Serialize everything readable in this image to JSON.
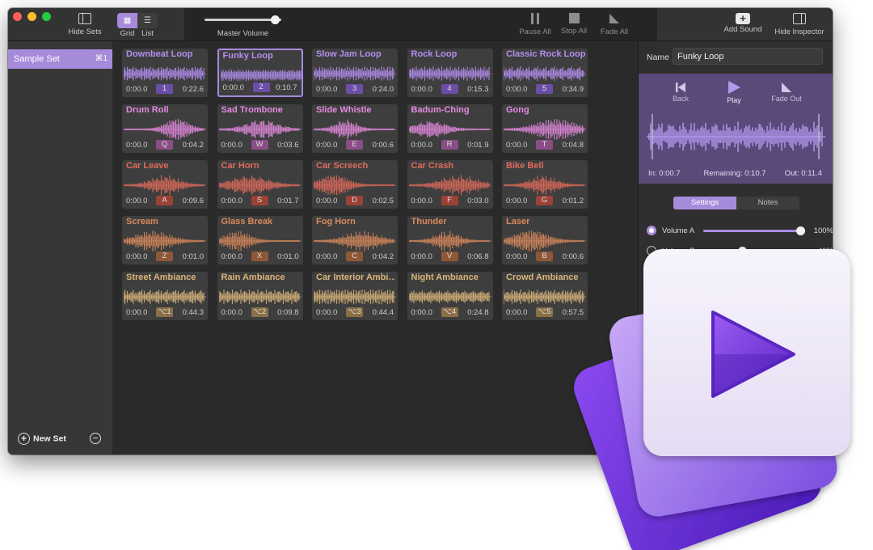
{
  "toolbar": {
    "hide_sets": "Hide Sets",
    "grid": "Grid",
    "list": "List",
    "master_volume": "Master Volume",
    "master_volume_level": 0.92,
    "pause_all": "Pause All",
    "stop_all": "Stop All",
    "fade_all": "Fade All",
    "add_sound": "Add Sound",
    "hide_inspector": "Hide Inspector"
  },
  "sidebar": {
    "sets": [
      {
        "name": "Sample Set",
        "shortcut": "⌘1",
        "selected": true
      }
    ],
    "new_set": "New Set"
  },
  "colors": {
    "purple": "#b48ef0",
    "pink": "#e58be0",
    "red": "#e06b5c",
    "orange": "#d98a5c",
    "yellow": "#d9b57a"
  },
  "sounds": [
    {
      "name": "Downbeat Loop",
      "start": "0:00.0",
      "key": "1",
      "end": "0:22.6",
      "color": "purple"
    },
    {
      "name": "Funky Loop",
      "start": "0:00.0",
      "key": "2",
      "end": "0:10.7",
      "color": "purple",
      "selected": true
    },
    {
      "name": "Slow Jam Loop",
      "start": "0:00.0",
      "key": "3",
      "end": "0:24.0",
      "color": "purple"
    },
    {
      "name": "Rock Loop",
      "start": "0:00.0",
      "key": "4",
      "end": "0:15.3",
      "color": "purple"
    },
    {
      "name": "Classic Rock Loop",
      "start": "0:00.0",
      "key": "5",
      "end": "0:34.9",
      "color": "purple"
    },
    {
      "name": "Drum Roll",
      "start": "0:00.0",
      "key": "Q",
      "end": "0:04.2",
      "color": "pink"
    },
    {
      "name": "Sad Trombone",
      "start": "0:00.0",
      "key": "W",
      "end": "0:03.6",
      "color": "pink"
    },
    {
      "name": "Slide Whistle",
      "start": "0:00.0",
      "key": "E",
      "end": "0:00.6",
      "color": "pink"
    },
    {
      "name": "Badum-Ching",
      "start": "0:00.0",
      "key": "R",
      "end": "0:01.9",
      "color": "pink"
    },
    {
      "name": "Gong",
      "start": "0:00.0",
      "key": "T",
      "end": "0:04.8",
      "color": "pink"
    },
    {
      "name": "Car Leave",
      "start": "0:00.0",
      "key": "A",
      "end": "0:09.6",
      "color": "red"
    },
    {
      "name": "Car Horn",
      "start": "0:00.0",
      "key": "S",
      "end": "0:01.7",
      "color": "red"
    },
    {
      "name": "Car Screech",
      "start": "0:00.0",
      "key": "D",
      "end": "0:02.5",
      "color": "red"
    },
    {
      "name": "Car Crash",
      "start": "0:00.0",
      "key": "F",
      "end": "0:03.0",
      "color": "red"
    },
    {
      "name": "Bike Bell",
      "start": "0:00.0",
      "key": "G",
      "end": "0:01.2",
      "color": "red"
    },
    {
      "name": "Scream",
      "start": "0:00.0",
      "key": "Z",
      "end": "0:01.0",
      "color": "orange"
    },
    {
      "name": "Glass Break",
      "start": "0:00.0",
      "key": "X",
      "end": "0:01.0",
      "color": "orange"
    },
    {
      "name": "Fog Horn",
      "start": "0:00.0",
      "key": "C",
      "end": "0:04.2",
      "color": "orange"
    },
    {
      "name": "Thunder",
      "start": "0:00.0",
      "key": "V",
      "end": "0:06.8",
      "color": "orange"
    },
    {
      "name": "Laser",
      "start": "0:00.0",
      "key": "B",
      "end": "0:00.6",
      "color": "orange"
    },
    {
      "name": "Street Ambiance",
      "start": "0:00.0",
      "key": "⌥1",
      "end": "0:44.3",
      "color": "yellow"
    },
    {
      "name": "Rain Ambiance",
      "start": "0:00.0",
      "key": "⌥2",
      "end": "0:09.8",
      "color": "yellow"
    },
    {
      "name": "Car Interior Ambi…",
      "start": "0:00.0",
      "key": "⌥3",
      "end": "0:44.4",
      "color": "yellow"
    },
    {
      "name": "Night Ambiance",
      "start": "0:00.0",
      "key": "⌥4",
      "end": "0:24.8",
      "color": "yellow"
    },
    {
      "name": "Crowd Ambiance",
      "start": "0:00.0",
      "key": "⌥5",
      "end": "0:57.5",
      "color": "yellow"
    }
  ],
  "inspector": {
    "name_label": "Name",
    "name_value": "Funky Loop",
    "back": "Back",
    "play": "Play",
    "fade_out": "Fade Out",
    "in": "In: 0:00.7",
    "remaining": "Remaining: 0:10.7",
    "out": "Out: 0:11.4",
    "tabs": {
      "settings": "Settings",
      "notes": "Notes",
      "active": "settings"
    },
    "volume_a": {
      "label": "Volume A",
      "pct": "100%",
      "level": 1.0,
      "selected": true
    },
    "volume_b": {
      "label": "Volume B",
      "pct": "40%",
      "level": 0.4,
      "selected": false
    }
  }
}
